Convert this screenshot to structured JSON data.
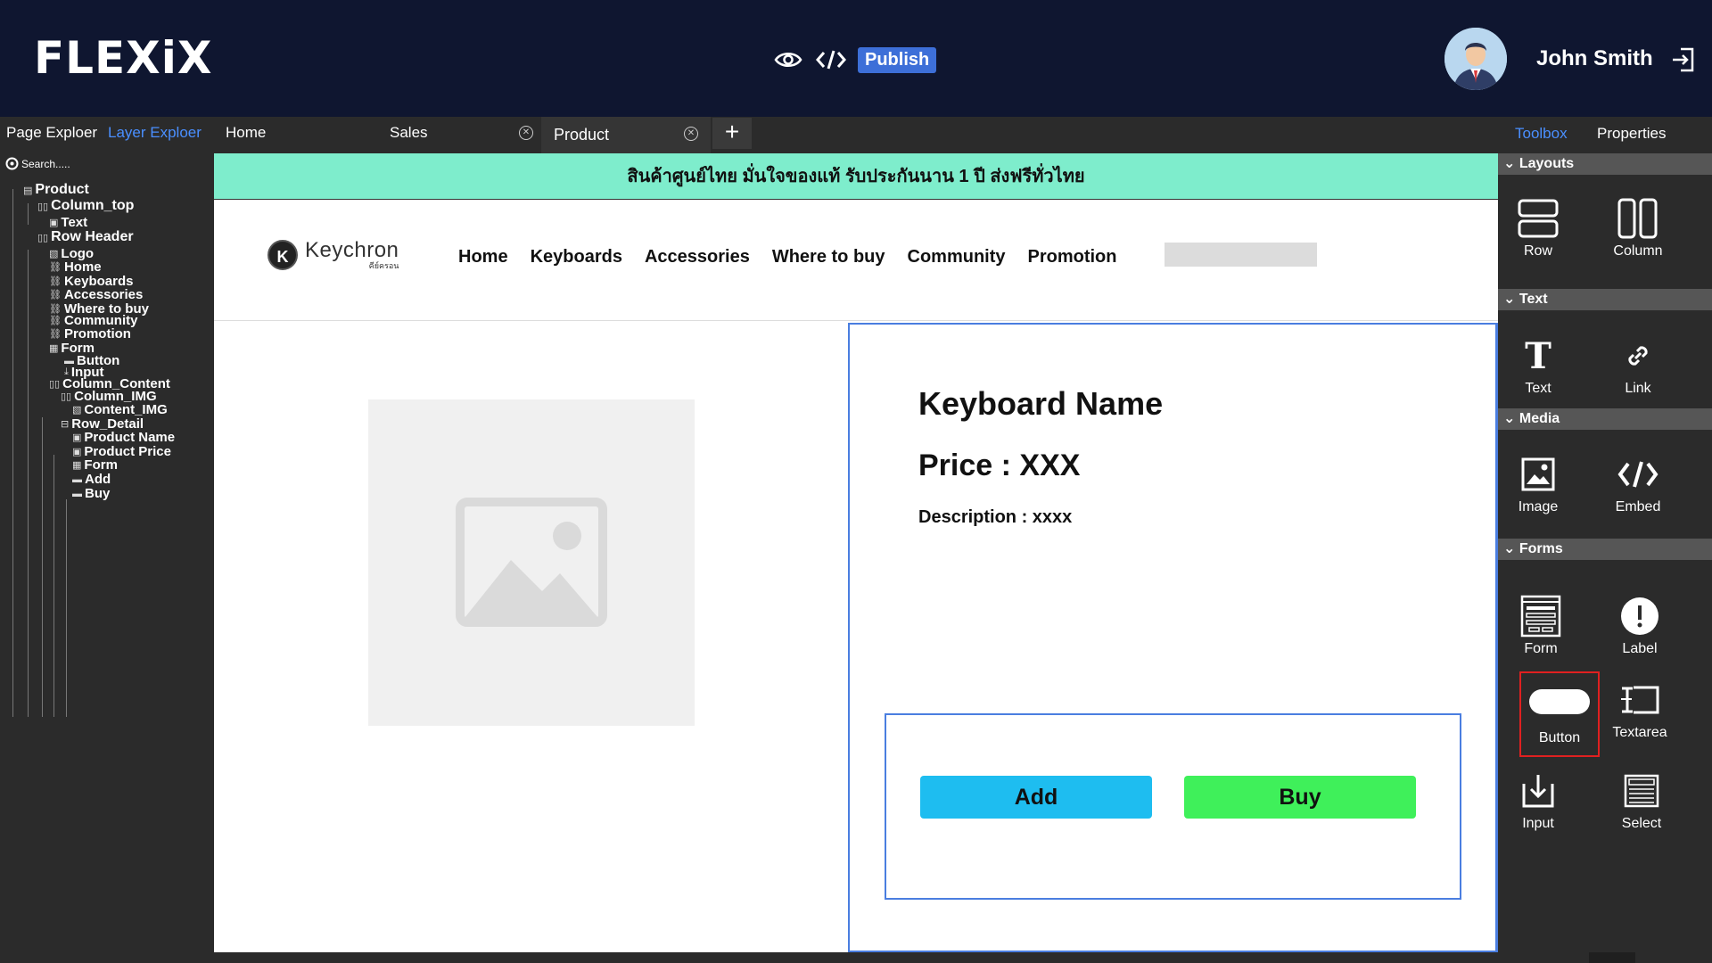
{
  "app": {
    "logo": "FLEXiX",
    "publish_label": "Publish",
    "user_name": "John Smith"
  },
  "left_tabs": {
    "page_explorer": "Page Exploer",
    "layer_explorer": "Layer Exploer"
  },
  "doc_tabs": [
    {
      "label": "Home"
    },
    {
      "label": "Sales"
    },
    {
      "label": "Product"
    }
  ],
  "search": {
    "placeholder": "Search....."
  },
  "tree": [
    {
      "label": "Product",
      "icon": "page-icon"
    },
    {
      "label": "Column_top",
      "icon": "column-icon"
    },
    {
      "label": "Text",
      "icon": "text-icon"
    },
    {
      "label": "Row Header",
      "icon": "column-icon"
    },
    {
      "label": "Logo",
      "icon": "image-icon"
    },
    {
      "label": "Home",
      "icon": "link-icon"
    },
    {
      "label": "Keyboards",
      "icon": "link-icon"
    },
    {
      "label": "Accessories",
      "icon": "link-icon"
    },
    {
      "label": "Where to buy",
      "icon": "link-icon"
    },
    {
      "label": "Community",
      "icon": "link-icon"
    },
    {
      "label": "Promotion",
      "icon": "link-icon"
    },
    {
      "label": "Form",
      "icon": "form-icon"
    },
    {
      "label": "Button",
      "icon": "button-icon"
    },
    {
      "label": "Input",
      "icon": "input-icon"
    },
    {
      "label": "Column_Content",
      "icon": "column-icon"
    },
    {
      "label": "Column_IMG",
      "icon": "column-icon"
    },
    {
      "label": "Content_IMG",
      "icon": "image-icon"
    },
    {
      "label": "Row_Detail",
      "icon": "row-icon"
    },
    {
      "label": "Product Name",
      "icon": "text-icon"
    },
    {
      "label": "Product Price",
      "icon": "text-icon"
    },
    {
      "label": "Form",
      "icon": "form-icon"
    },
    {
      "label": "Add",
      "icon": "button-icon"
    },
    {
      "label": "Buy",
      "icon": "button-icon"
    }
  ],
  "canvas": {
    "banner": "สินค้าศูนย์ไทย มั่นใจของแท้ รับประกันนาน 1 ปี ส่งฟรีทั่วไทย",
    "brand": "Keychron",
    "brand_sub": "คีย์ครอน",
    "nav": [
      "Home",
      "Keyboards",
      "Accessories",
      "Where to buy",
      "Community",
      "Promotion"
    ],
    "product_name": "Keyboard Name",
    "product_price": "Price : XXX",
    "product_desc": "Description : xxxx",
    "add_label": "Add",
    "buy_label": "Buy"
  },
  "right_tabs": {
    "toolbox": "Toolbox",
    "properties": "Properties"
  },
  "toolbox": {
    "layouts": "Layouts",
    "row": "Row",
    "column": "Column",
    "text_section": "Text",
    "text": "Text",
    "link": "Link",
    "media": "Media",
    "image": "Image",
    "embed": "Embed",
    "forms": "Forms",
    "form": "Form",
    "label": "Label",
    "button": "Button",
    "textarea": "Textarea",
    "input": "Input",
    "select": "Select"
  },
  "colors": {
    "topbar": "#0f1630",
    "accent_blue": "#4a8fff",
    "publish": "#3d6fd8",
    "banner": "#7eedcc",
    "add_button": "#1ebdf0",
    "buy_button": "#3ff05a",
    "selection_border": "#4a7ee0",
    "highlight_red": "#e02020"
  }
}
